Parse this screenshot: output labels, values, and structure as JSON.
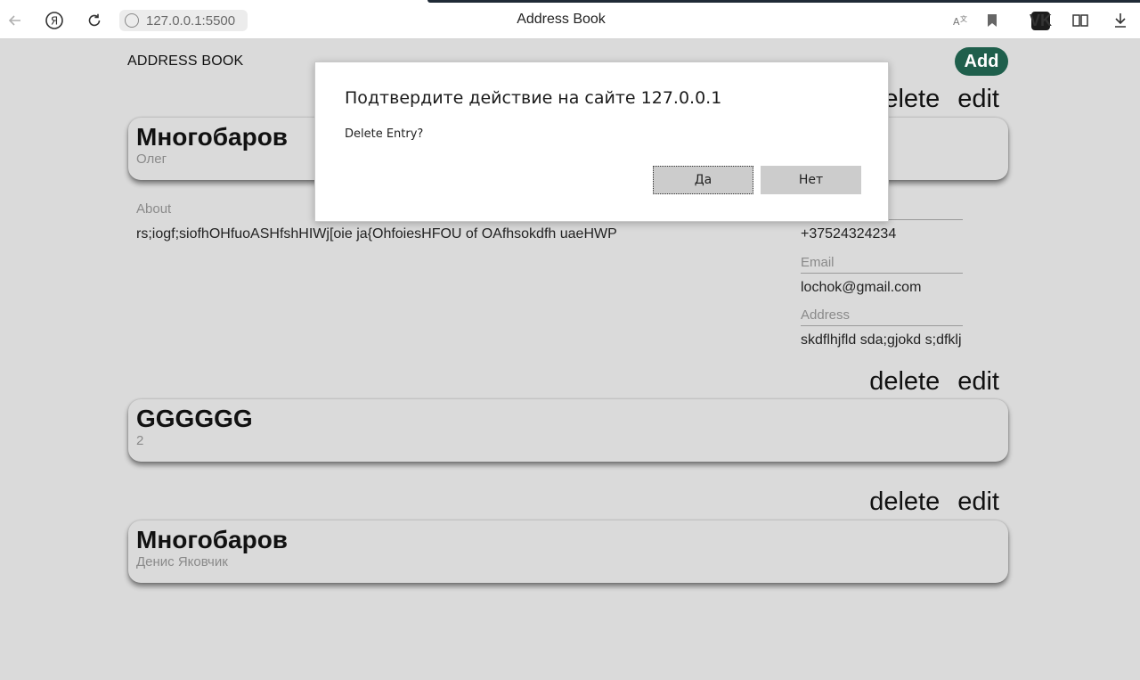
{
  "browser": {
    "url": "127.0.0.1:5500",
    "tab_title": "Address Book",
    "icons": [
      "back-icon",
      "yandex-icon",
      "reload-icon",
      "site-info-icon",
      "translate-icon",
      "bookmark-icon",
      "vk-icon",
      "reader-icon",
      "download-icon"
    ],
    "vk_label": "VK"
  },
  "header": {
    "title": "ADDRESS BOOK",
    "add_label": "Add"
  },
  "actions": {
    "delete_label": "delete",
    "edit_label": "edit"
  },
  "contacts": [
    {
      "surname": "Многобаров",
      "given": "Олег",
      "about_label": "About",
      "about": "rs;iogf;siofhOHfuoASHfshHIWj[oie ja{OhfoiesHFOU of OAfhsokdfh uaeHWP",
      "phone": "+37524324234",
      "email_label": "Email",
      "email": "lochok@gmail.com",
      "address_label": "Address",
      "address": "skdflhjfld sda;gjokd s;dfklj"
    },
    {
      "surname": "GGGGGG",
      "given": "2"
    },
    {
      "surname": "Многобаров",
      "given": "Денис Яковчик"
    }
  ],
  "dialog": {
    "title": "Подтвердите действие на сайте 127.0.0.1",
    "message": "Delete Entry?",
    "yes_label": "Да",
    "no_label": "Нет"
  },
  "colors": {
    "page_bg": "#dadada",
    "add_button": "#1f5f4c",
    "dialog_button": "#cccccc"
  }
}
